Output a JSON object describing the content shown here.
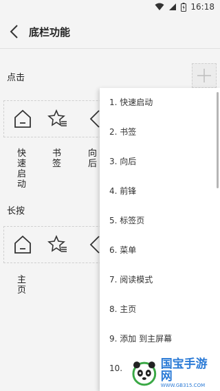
{
  "status": {
    "time": "16:18"
  },
  "header": {
    "title": "底栏功能"
  },
  "sections": {
    "click_label": "点击",
    "longpress_label": "长按"
  },
  "click_row": {
    "labels": [
      "快速启动",
      "书签",
      "向后"
    ]
  },
  "longpress_row": {
    "labels": [
      "主页"
    ]
  },
  "menu": {
    "items": [
      "1. 快速启动",
      "2. 书签",
      "3. 向后",
      "4. 前锋",
      "5. 标签页",
      "6. 菜单",
      "7. 阅读模式",
      "8. 主页",
      "9. 添加 到主屏幕",
      "10."
    ]
  },
  "watermark": {
    "text": "国宝手游网",
    "sub": "WWW.GB315.COM"
  },
  "colors": {
    "accent": "#2a7ad6",
    "background": "#f4f4f4"
  }
}
